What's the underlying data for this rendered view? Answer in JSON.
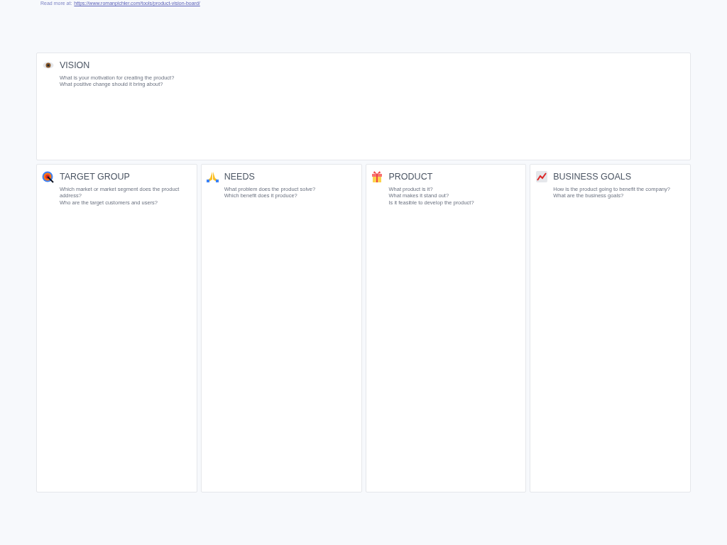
{
  "read_more": {
    "label": "Read more at:",
    "link": "https://www.romanpichler.com/tools/product-vision-board/"
  },
  "vision": {
    "title": "VISION",
    "questions": [
      "What is your motivation for creating the product?",
      "What positive change should it bring about?"
    ]
  },
  "sections": [
    {
      "title": "TARGET GROUP",
      "questions": [
        "Which market or market segment does the product address?",
        "Who are the target customers and users?"
      ]
    },
    {
      "title": "NEEDS",
      "questions": [
        "What problem does the product solve?",
        "Which benefit does it produce?"
      ]
    },
    {
      "title": "PRODUCT",
      "questions": [
        "What product is it?",
        "What makes it stand out?",
        "Is it feasible to develop the product?"
      ]
    },
    {
      "title": "BUSINESS GOALS",
      "questions": [
        "How is the product going to benefit the company?",
        "What are the business goals?"
      ]
    }
  ]
}
